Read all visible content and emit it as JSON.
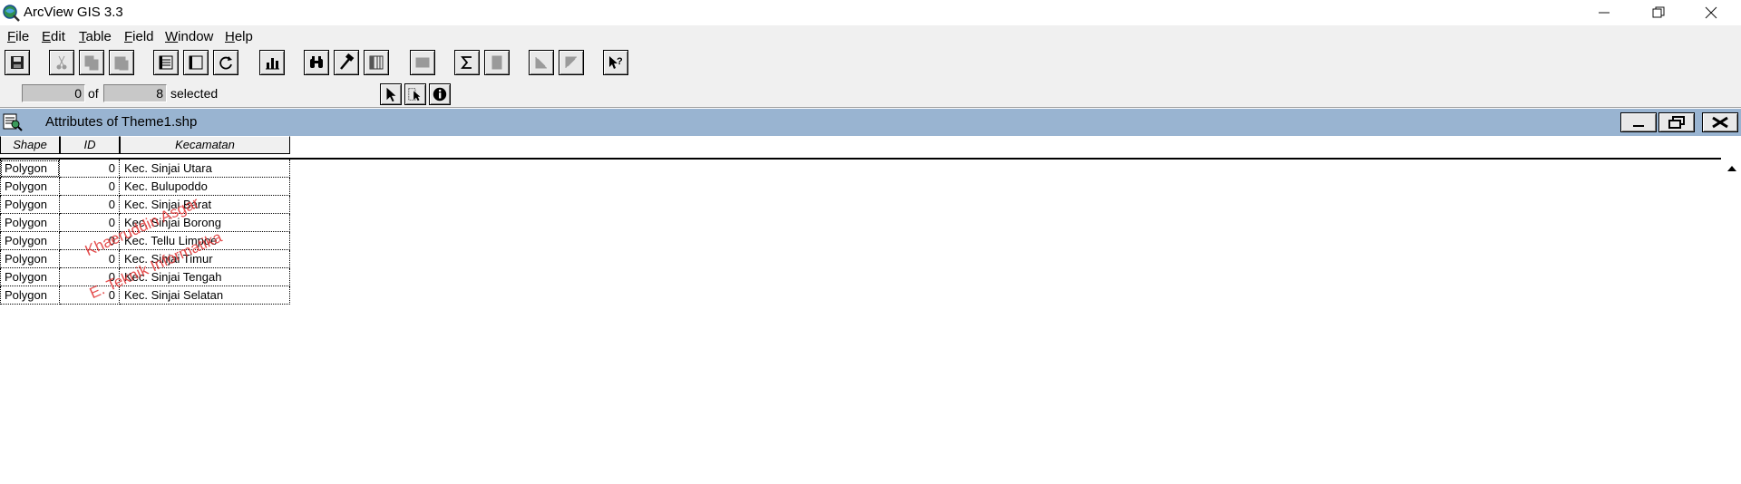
{
  "app": {
    "title": "ArcView GIS 3.3"
  },
  "window_controls": {
    "minimize": "—",
    "restore": "❐",
    "close": "✕"
  },
  "menu": [
    {
      "label": "File",
      "key": "F",
      "rest": "ile"
    },
    {
      "label": "Edit",
      "key": "E",
      "rest": "dit"
    },
    {
      "label": "Table",
      "key": "T",
      "rest": "able"
    },
    {
      "label": "Field",
      "key": "F",
      "rest": "ield"
    },
    {
      "label": "Window",
      "key": "W",
      "rest": "indow"
    },
    {
      "label": "Help",
      "key": "H",
      "rest": "elp"
    }
  ],
  "toolbar_icons": [
    "save-icon",
    "cut-icon",
    "copy-icon",
    "paste-icon",
    "select-all-icon",
    "select-none-icon",
    "refresh-icon",
    "chart-icon",
    "find-icon",
    "query-icon",
    "table-columns-icon",
    "promote-icon",
    "summarize-icon",
    "calculate-icon",
    "sort-ascending-icon",
    "sort-descending-icon",
    "help-icon"
  ],
  "status": {
    "selected_count": "0",
    "of_label": "of",
    "total_count": "8",
    "selected_label": "selected"
  },
  "child_window": {
    "title": "Attributes of Theme1.shp"
  },
  "table": {
    "columns": [
      "Shape",
      "ID",
      "Kecamatan"
    ],
    "rows": [
      {
        "shape": "Polygon",
        "id": "0",
        "kecamatan": "Kec. Sinjai Utara"
      },
      {
        "shape": "Polygon",
        "id": "0",
        "kecamatan": "Kec. Bulupoddo"
      },
      {
        "shape": "Polygon",
        "id": "0",
        "kecamatan": "Kec. Sinjai Barat"
      },
      {
        "shape": "Polygon",
        "id": "0",
        "kecamatan": "Kec. Sinjai Borong"
      },
      {
        "shape": "Polygon",
        "id": "0",
        "kecamatan": "Kec. Tellu Limpoe"
      },
      {
        "shape": "Polygon",
        "id": "0",
        "kecamatan": "Kec. Sinjai Timur"
      },
      {
        "shape": "Polygon",
        "id": "0",
        "kecamatan": "Kec. Sinjai Tengah"
      },
      {
        "shape": "Polygon",
        "id": "0",
        "kecamatan": "Kec. Sinjai Selatan"
      }
    ]
  },
  "watermark": {
    "line1": "Khaeruddin Asgar",
    "line2": "E. Teknik Informatika"
  },
  "colors": {
    "child_title_bg": "#99b4d1",
    "chrome_bg": "#f0f0f0",
    "watermark": "#e23b3b"
  }
}
